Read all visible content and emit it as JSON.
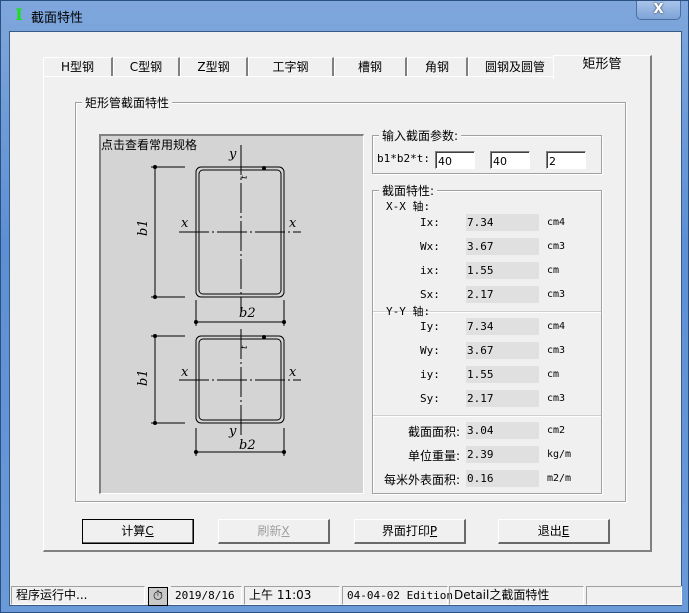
{
  "window": {
    "title": "截面特性",
    "icon": "I-beam-icon",
    "close_label": "X"
  },
  "tabs": [
    {
      "label": "H型钢",
      "active": false
    },
    {
      "label": "C型钢",
      "active": false
    },
    {
      "label": "Z型钢",
      "active": false
    },
    {
      "label": "工字钢",
      "active": false
    },
    {
      "label": "槽钢",
      "active": false
    },
    {
      "label": "角钢",
      "active": false
    },
    {
      "label": "圆钢及圆管",
      "active": false
    },
    {
      "label": "矩形管",
      "active": true
    }
  ],
  "panel": {
    "group_title": "矩形管截面特性",
    "drawing_link": "点击查看常用规格",
    "drawing_labels": {
      "y": "y",
      "x": "x",
      "b1": "b1",
      "b2": "b2",
      "t": "t"
    }
  },
  "input_group": {
    "title": "输入截面参数:",
    "label": "b1*b2*t:",
    "b1": "40",
    "b2": "40",
    "t": "2"
  },
  "properties": {
    "title": "截面特性:",
    "xx_axis_label": "X-X 轴:",
    "yy_axis_label": "Y-Y 轴:",
    "xx": [
      {
        "label": "Ix:",
        "value": "7.34",
        "unit": "cm4"
      },
      {
        "label": "Wx:",
        "value": "3.67",
        "unit": "cm3"
      },
      {
        "label": "ix:",
        "value": "1.55",
        "unit": "cm"
      },
      {
        "label": "Sx:",
        "value": "2.17",
        "unit": "cm3"
      }
    ],
    "yy": [
      {
        "label": "Iy:",
        "value": "7.34",
        "unit": "cm4"
      },
      {
        "label": "Wy:",
        "value": "3.67",
        "unit": "cm3"
      },
      {
        "label": "iy:",
        "value": "1.55",
        "unit": "cm"
      },
      {
        "label": "Sy:",
        "value": "2.17",
        "unit": "cm3"
      }
    ],
    "general": [
      {
        "label": "截面面积:",
        "value": "3.04",
        "unit": "cm2"
      },
      {
        "label": "单位重量:",
        "value": "2.39",
        "unit": "kg/m"
      },
      {
        "label": "每米外表面积:",
        "value": "0.16",
        "unit": "m2/m"
      }
    ]
  },
  "buttons": {
    "calc": {
      "label": "计算",
      "hotkey": "C",
      "enabled": true
    },
    "refresh": {
      "label": "刷新",
      "hotkey": "X",
      "enabled": false
    },
    "print": {
      "label": "界面打印",
      "hotkey": "P",
      "enabled": true
    },
    "exit": {
      "label": "退出",
      "hotkey": "E",
      "enabled": true
    }
  },
  "statusbar": {
    "status": "程序运行中...",
    "clock_icon": "stopwatch-icon",
    "date": "2019/8/16",
    "time": "上午 11:03",
    "edition": "04-04-02 Edition",
    "module": "Detail之截面特性",
    "extra": ""
  }
}
